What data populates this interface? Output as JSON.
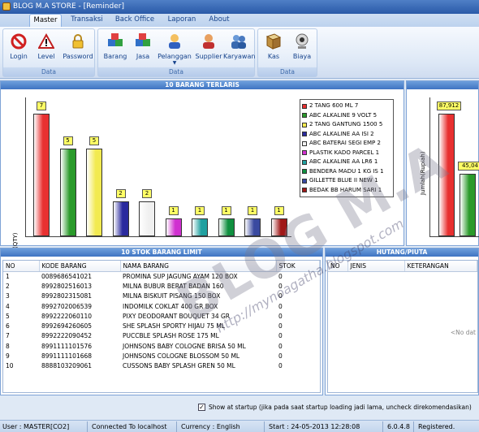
{
  "window": {
    "title": "BLOG M.A STORE - [Reminder]"
  },
  "menu": {
    "tabs": [
      "Master",
      "Transaksi",
      "Back Office",
      "Laporan",
      "About"
    ]
  },
  "ribbon": {
    "groups": [
      {
        "caption": "Data",
        "buttons": [
          {
            "label": "Login",
            "icon": "no-entry-icon"
          },
          {
            "label": "Level",
            "icon": "warning-icon"
          },
          {
            "label": "Password",
            "icon": "lock-icon"
          }
        ]
      },
      {
        "caption": "Data",
        "buttons": [
          {
            "label": "Barang",
            "icon": "boxes-icon"
          },
          {
            "label": "Jasa",
            "icon": "boxes-icon"
          },
          {
            "label": "Pelanggan",
            "icon": "customer-icon"
          },
          {
            "label": "Supplier",
            "icon": "person-icon"
          },
          {
            "label": "Karyawan",
            "icon": "people-icon"
          }
        ]
      },
      {
        "caption": "Data",
        "buttons": [
          {
            "label": "Kas",
            "icon": "book-icon"
          },
          {
            "label": "Biaya",
            "icon": "webcam-icon"
          }
        ]
      }
    ]
  },
  "top10": {
    "header": "10 BARANG TERLARIS"
  },
  "chart_data": [
    {
      "type": "bar",
      "ylabel": "Jumlah(QTY)",
      "categories": [
        "2 TANG 600 ML",
        "ABC ALKALINE 9 VOLT",
        "2 TANG GANTUNG 1500",
        "ABC ALKALINE AA ISI",
        "ABC BATERAI SEGI EMP",
        "PLASTIK KADO PARCEL",
        "ABC ALKALINE AA LR6",
        "BENDERA MADU 1 KG IS",
        "GILLETTE BLUE II NEW",
        "BEDAK BB HARUM SARI"
      ],
      "values": [
        7,
        5,
        5,
        2,
        2,
        1,
        1,
        1,
        1,
        1
      ],
      "legend": [
        "2 TANG 600 ML  7",
        "ABC ALKALINE 9 VOLT  5",
        "2 TANG GANTUNG 1500  5",
        "ABC ALKALINE AA ISI  2",
        "ABC BATERAI SEGI EMP  2",
        "PLASTIK KADO PARCEL  1",
        "ABC ALKALINE AA LR6  1",
        "BENDERA MADU 1 KG IS  1",
        "GILLETTE BLUE II NEW  1",
        "BEDAK BB HARUM SARI  1"
      ],
      "colors": [
        "#e83030",
        "#2a9a2a",
        "#f2ea50",
        "#2a2a9e",
        "#f0f0f0",
        "#d030d0",
        "#20a0a0",
        "#109040",
        "#3a4aa0",
        "#a01818"
      ],
      "legend_placement": "right",
      "grid": false
    },
    {
      "type": "bar",
      "ylabel": "Jumlah(Rupiah)",
      "values": [
        87912,
        45040
      ],
      "value_labels": [
        "87,912",
        "45,04"
      ],
      "colors": [
        "#e83030",
        "#2a9a2a"
      ]
    }
  ],
  "stock": {
    "header": "10 STOK BARANG LIMIT",
    "columns": [
      "NO",
      "KODE BARANG",
      "NAMA BARANG",
      "STOK"
    ],
    "rows": [
      [
        "1",
        "0089686541021",
        "PROMINA SUP JAGUNG AYAM 120 BOX",
        "0"
      ],
      [
        "2",
        "8992802516013",
        "MILNA BUBUR BERAT BADAN 160",
        "0"
      ],
      [
        "3",
        "8992802315081",
        "MILNA BISKUIT PISANG 150 BOX",
        "0"
      ],
      [
        "4",
        "8992702006539",
        "INDOMILK COKLAT 400 GR BOX",
        "0"
      ],
      [
        "5",
        "8992222060110",
        "PIXY DEODORANT BOUQUET 34 GR",
        "0"
      ],
      [
        "6",
        "8992694260605",
        "SHE SPLASH SPORTY HIJAU 75 ML",
        "0"
      ],
      [
        "7",
        "8992222090452",
        "PUCCBLE SPLASH ROSE 175 ML",
        "0"
      ],
      [
        "8",
        "8991111101576",
        "JOHNSONS BABY COLOGNE BRISA 50 ML",
        "0"
      ],
      [
        "9",
        "8991111101668",
        "JOHNSONS COLOGNE BLOSSOM 50 ML",
        "0"
      ],
      [
        "10",
        "8888103209061",
        "CUSSONS BABY SPLASH GREN 50 ML",
        "0"
      ]
    ]
  },
  "hutang": {
    "header": "HUTANG/PIUTA",
    "columns": [
      "NO",
      "JENIS",
      "KETERANGAN"
    ],
    "empty_text": "<No dat"
  },
  "startup": {
    "checked": true,
    "label": "Show at startup (jika pada saat startup loading jadi lama, uncheck direkomendasikan)"
  },
  "watermark": {
    "text": "BLOG M.A",
    "url": "http://mynoagatha.blogspot.com"
  },
  "status": {
    "user": "User : MASTER[CO2]",
    "connection": "Connected To localhost",
    "currency": "Currency : English",
    "start": "Start  : 24-05-2013 12:28:08",
    "version": "6.0.4.8",
    "registered": "Registered."
  }
}
